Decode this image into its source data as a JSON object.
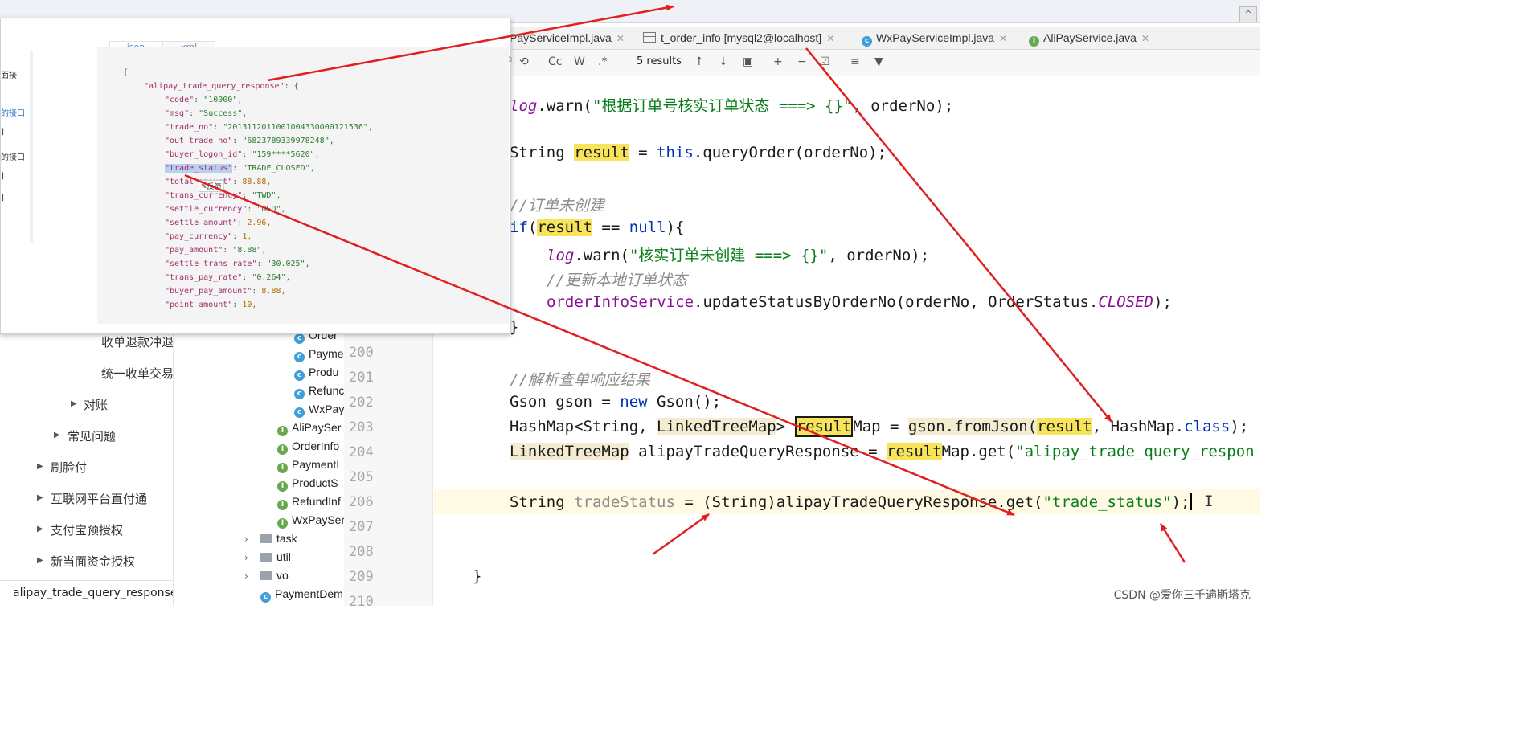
{
  "doc_nav": {
    "items": [
      {
        "label": "收单退款冲退"
      },
      {
        "label": "统一收单交易"
      },
      {
        "label": "对账"
      },
      {
        "label": "常见问题"
      },
      {
        "label": "刷脸付"
      },
      {
        "label": "互联网平台直付通"
      },
      {
        "label": "支付宝预授权"
      },
      {
        "label": "新当面资金授权"
      }
    ],
    "footer_label": "alipay_trade_query_response"
  },
  "project_tree": {
    "classes": [
      "Order",
      "Payme",
      "Produ",
      "Refunc",
      "WxPay"
    ],
    "interfaces": [
      "AliPaySer",
      "OrderInfo",
      "PaymentI",
      "ProductS",
      "RefundInf",
      "WxPaySer"
    ],
    "folders": [
      "task",
      "util",
      "vo"
    ],
    "last": "PaymentDem"
  },
  "gutter_lines": [
    "200",
    "201",
    "202",
    "203",
    "204",
    "205",
    "206",
    "207",
    "208",
    "209",
    "210"
  ],
  "editor_tabs": [
    {
      "label": "PayServiceImpl.java",
      "icon": "none"
    },
    {
      "label": "t_order_info [mysql2@localhost]",
      "icon": "table-icon"
    },
    {
      "label": "WxPayServiceImpl.java",
      "icon": "class-icon"
    },
    {
      "label": "AliPayService.java",
      "icon": "interface-icon"
    }
  ],
  "find_bar": {
    "results": "5 results",
    "case_label": "Cc",
    "word_label": "W",
    "regex_label": ".*"
  },
  "code": {
    "l1_a": "log",
    "l1_b": ".warn(",
    "l1_str": "\"根据订单号核实订单状态 ===> {}\"",
    "l1_c": ", orderNo);",
    "l2_a": "String ",
    "l2_hl": "result",
    "l2_b": " = ",
    "l2_kw": "this",
    "l2_c": ".queryOrder(orderNo);",
    "c1": "//订单未创建",
    "l3_kw": "if",
    "l3_a": "(",
    "l3_hl": "result",
    "l3_b": " == ",
    "l3_kw2": "null",
    "l3_c": "){",
    "l4_a": "log",
    "l4_b": ".warn(",
    "l4_str": "\"核实订单未创建 ===> {}\"",
    "l4_c": ", orderNo);",
    "c2": "//更新本地订单状态",
    "l5_a": "orderInfoService",
    "l5_b": ".updateStatusByOrderNo(orderNo, OrderStatus.",
    "l5_fld": "CLOSED",
    "l5_c": ");",
    "close1": "}",
    "c3": "//解析查单响应结果",
    "l6_a": "Gson gson = ",
    "l6_kw": "new",
    "l6_b": " Gson();",
    "l7_a": "HashMap<String, ",
    "l7_hl2": "LinkedTreeMap",
    "l7_b": "> ",
    "l7_box": "result",
    "l7_c": "Map = ",
    "l7_hl3": "gson.fromJson(",
    "l7_hl4": "result",
    "l7_d": ", HashMap.",
    "l7_kw": "class",
    "l7_e": ");",
    "l8_hl2": "LinkedTreeMap",
    "l8_a": " alipayTradeQueryResponse = ",
    "l8_hl": "result",
    "l8_b": "Map.get(",
    "l8_str": "\"alipay_trade_query_respon",
    "l9_a": "String ",
    "l9_var": "tradeStatus",
    "l9_b": " = (String)alipayTradeQueryResponse.get(",
    "l9_str": "\"trade_status\"",
    "l9_c": ");",
    "close2": "}"
  },
  "doc_panel": {
    "tabs": [
      "json",
      "xml"
    ],
    "side_labels": [
      "面接",
      "的接口",
      "]",
      "的接口",
      "]",
      "]"
    ],
    "json_lines": [
      {
        "t": "{"
      },
      {
        "k": "\"alipay_trade_query_response\"",
        "v": "{"
      },
      {
        "k": "\"code\"",
        "v": "\"10000\","
      },
      {
        "k": "\"msg\"",
        "v": "\"Success\","
      },
      {
        "k": "\"trade_no\"",
        "v": "\"2013112011001004330000121536\","
      },
      {
        "k": "\"out_trade_no\"",
        "v": "\"6823789339978248\","
      },
      {
        "k": "\"buyer_logon_id\"",
        "v": "\"159****5620\","
      },
      {
        "k": "\"trade_status\"",
        "v": "\"TRADE_CLOSED\",",
        "sel": true
      },
      {
        "k": "\"total_amount\"",
        "v": "88.88,",
        "popup": "反馈"
      },
      {
        "k": "\"trans_currency\"",
        "v": "\"TWD\","
      },
      {
        "k": "\"settle_currency\"",
        "v": "\"USD\","
      },
      {
        "k": "\"settle_amount\"",
        "v": "2.96,"
      },
      {
        "k": "\"pay_currency\"",
        "v": "1,"
      },
      {
        "k": "\"pay_amount\"",
        "v": "\"8.88\","
      },
      {
        "k": "\"settle_trans_rate\"",
        "v": "\"30.025\","
      },
      {
        "k": "\"trans_pay_rate\"",
        "v": "\"0.264\","
      },
      {
        "k": "\"buyer_pay_amount\"",
        "v": "8.88,"
      },
      {
        "k": "\"point_amount\"",
        "v": "10,"
      }
    ]
  },
  "watermark": "CSDN @爱你三千遍斯塔克",
  "colors": {
    "annotation": "#e02020",
    "keyword": "#0033b3",
    "string": "#067d17",
    "search_highlight": "#f7e45a"
  }
}
